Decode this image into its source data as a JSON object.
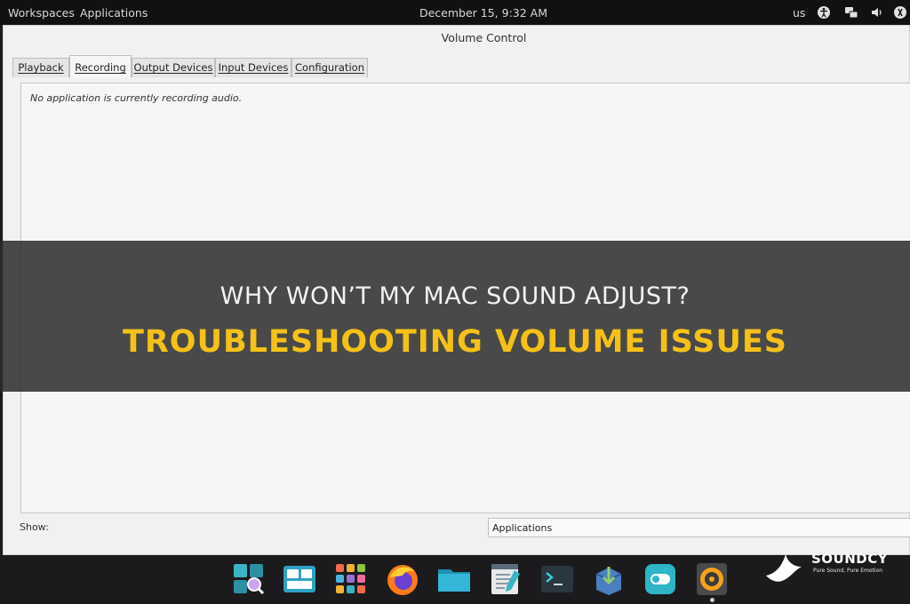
{
  "topbar": {
    "workspaces": "Workspaces",
    "applications": "Applications",
    "clock": "December 15, 9:32 AM",
    "keyboard_layout": "us",
    "tray_icons": [
      "accessibility-icon",
      "network-icon",
      "volume-icon",
      "power-icon"
    ]
  },
  "window": {
    "title": "Volume Control",
    "tabs": [
      "Playback",
      "Recording",
      "Output Devices",
      "Input Devices",
      "Configuration"
    ],
    "active_tab": "Recording",
    "empty_message": "No application is currently recording audio.",
    "show_label": "Show:",
    "show_value": "Applications"
  },
  "banner": {
    "headline": "WHY WON’T MY MAC SOUND ADJUST?",
    "subhead": "TROUBLESHOOTING VOLUME ISSUES"
  },
  "dock": {
    "icons": [
      "search-apps-icon",
      "window-manager-icon",
      "app-grid-icon",
      "firefox-icon",
      "file-manager-icon",
      "text-editor-icon",
      "terminal-icon",
      "package-installer-icon",
      "toggle-settings-icon",
      "volume-control-icon"
    ],
    "active": "volume-control-icon"
  },
  "brand": {
    "name": "SOUNDCY",
    "tagline": "Pure Sound, Pure Emotion"
  },
  "colors": {
    "subhead": "#f5c117",
    "banner_bg": "#2c2c2c",
    "window_bg": "#f1f1f1"
  }
}
